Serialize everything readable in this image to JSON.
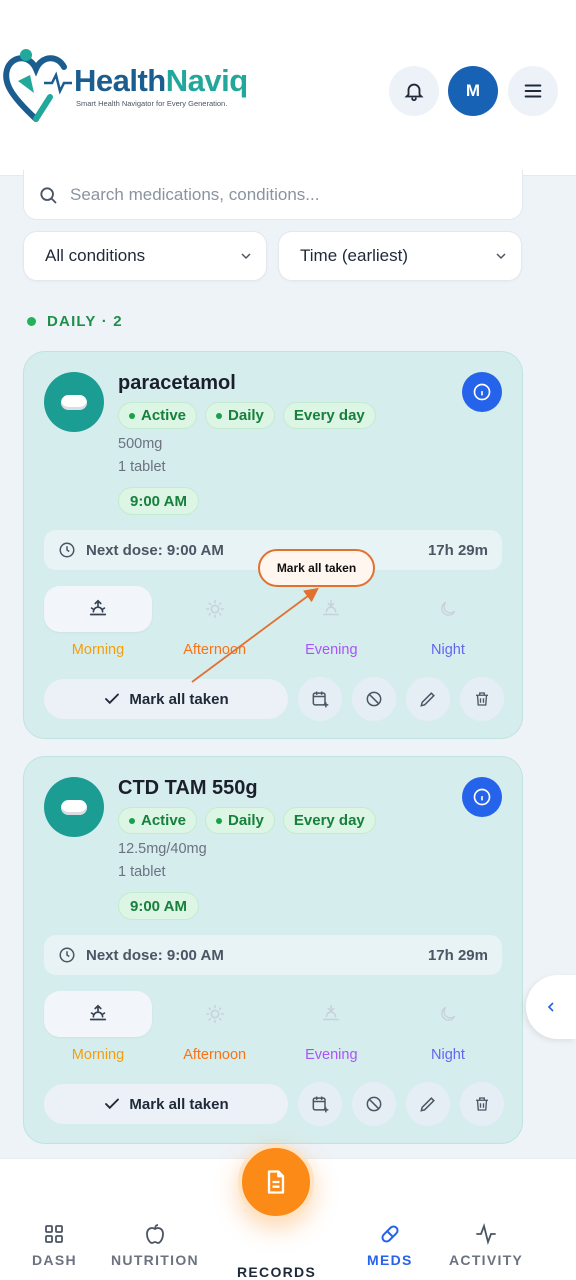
{
  "header": {
    "brand_part1": "Health",
    "brand_part2": "Naviq",
    "tagline": "Smart Health Navigator for Every Generation.",
    "avatar_initial": "M"
  },
  "search": {
    "placeholder": "Search medications, conditions..."
  },
  "filters": {
    "condition": "All conditions",
    "sort": "Time (earliest)"
  },
  "section": {
    "label": "DAILY · 2"
  },
  "medications": [
    {
      "name": "paracetamol",
      "badges": [
        "Active",
        "Daily",
        "Every day"
      ],
      "dose": "500mg",
      "quantity": "1 tablet",
      "time": "9:00 AM",
      "next_dose": "Next dose: 9:00 AM",
      "countdown": "17h 29m",
      "periods": [
        "Morning",
        "Afternoon",
        "Evening",
        "Night"
      ],
      "mark_all": "Mark all taken"
    },
    {
      "name": "CTD TAM 550g",
      "badges": [
        "Active",
        "Daily",
        "Every day"
      ],
      "dose": "12.5mg/40mg",
      "quantity": "1 tablet",
      "time": "9:00 AM",
      "next_dose": "Next dose: 9:00 AM",
      "countdown": "17h 29m",
      "periods": [
        "Morning",
        "Afternoon",
        "Evening",
        "Night"
      ],
      "mark_all": "Mark all taken"
    }
  ],
  "annotation": {
    "text": "Mark all taken"
  },
  "colors": {
    "morning": "#f59e0b",
    "afternoon": "#f97316",
    "evening": "#a855f7",
    "night": "#6366f1",
    "accent": "#2563eb"
  },
  "nav": [
    {
      "label": "DASH",
      "icon": "grid-icon"
    },
    {
      "label": "NUTRITION",
      "icon": "apple-icon"
    },
    {
      "label": "RECORDS",
      "icon": "document-icon"
    },
    {
      "label": "MEDS",
      "icon": "pill-icon"
    },
    {
      "label": "ACTIVITY",
      "icon": "pulse-icon"
    }
  ]
}
